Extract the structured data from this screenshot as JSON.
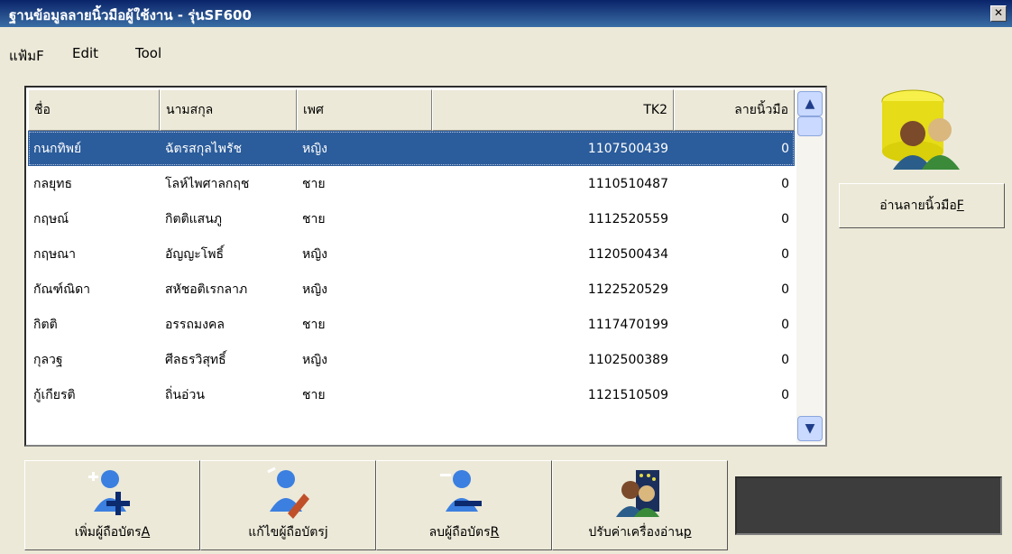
{
  "window": {
    "title": "ฐานข้อมูลลายนิ้วมือผู้ใช้งาน - รุ่นSF600",
    "close_glyph": "✕"
  },
  "menu": [
    {
      "label": "แฟ้มF"
    },
    {
      "label": "Edit"
    },
    {
      "label": "Tool"
    }
  ],
  "table": {
    "columns": [
      "ชื่อ",
      "นามสกุล",
      "เพศ",
      "TK2",
      "ลายนิ้วมือ"
    ],
    "rows": [
      {
        "first": "กนกทิพย์",
        "last": "ฉัตรสกุลไพรัช",
        "gender": "หญิง",
        "tk2": "1107500439",
        "fp": "0",
        "selected": true
      },
      {
        "first": "กลยุทธ",
        "last": "โลห์ไพศาลกฤช",
        "gender": "ชาย",
        "tk2": "1110510487",
        "fp": "0"
      },
      {
        "first": "กฤษณ์",
        "last": "กิตติแสนภู",
        "gender": "ชาย",
        "tk2": "1112520559",
        "fp": "0"
      },
      {
        "first": "กฤษณา",
        "last": "อัญญะโพธิ์",
        "gender": "หญิง",
        "tk2": "1120500434",
        "fp": "0"
      },
      {
        "first": "กัณฑ์ณิดา",
        "last": "สหัชอติเรกลาภ",
        "gender": "หญิง",
        "tk2": "1122520529",
        "fp": "0"
      },
      {
        "first": "กิตติ",
        "last": "อรรถมงคล",
        "gender": "ชาย",
        "tk2": "1117470199",
        "fp": "0"
      },
      {
        "first": "กุลวฐ",
        "last": "ศีลธรวิสุทธิ์",
        "gender": "หญิง",
        "tk2": "1102500389",
        "fp": "0"
      },
      {
        "first": "กู้เกียรติ",
        "last": "ถิ่นอ่วน",
        "gender": "ชาย",
        "tk2": "1121510509",
        "fp": "0"
      }
    ]
  },
  "side": {
    "read_button": "อ่านลายนิ้วมือ",
    "read_button_key": "F",
    "icon": "database-users-icon"
  },
  "toolbar": [
    {
      "label": "เพิ่มผู้ถือบัตร",
      "key": "A",
      "icon": "add-user-icon"
    },
    {
      "label": "แก้ไขผู้ถือบัตร",
      "key": "j",
      "icon": "edit-user-icon"
    },
    {
      "label": "ลบผู้ถือบัตร",
      "key": "R",
      "icon": "remove-user-icon"
    },
    {
      "label": "ปรับค่าเครื่องอ่าน",
      "key": "p",
      "icon": "reader-settings-icon"
    }
  ],
  "colors": {
    "titlebar": "#0a246a",
    "selection": "#2b5c9b",
    "status_panel": "#3d3d3d"
  }
}
